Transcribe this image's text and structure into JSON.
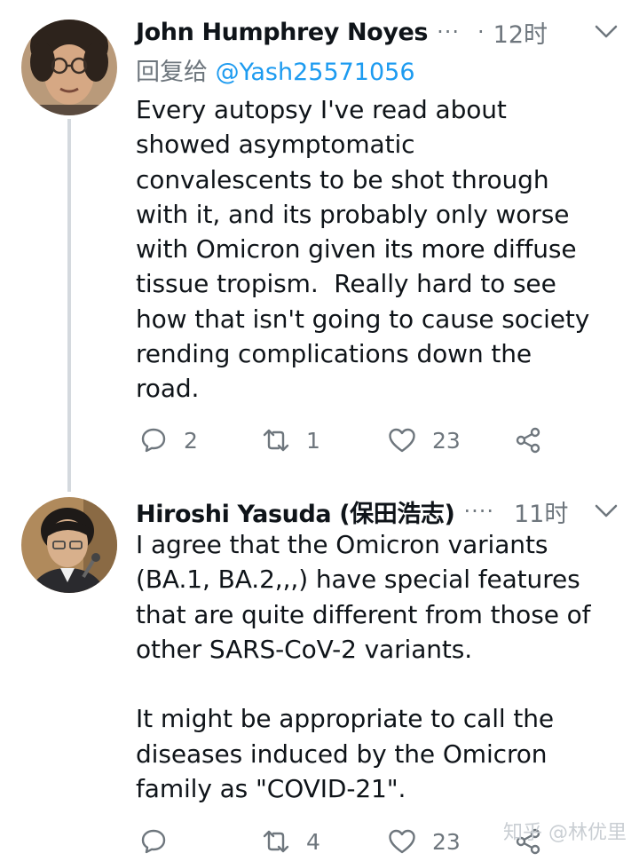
{
  "tweets": [
    {
      "author": "John Humphrey Noyes",
      "more": "···",
      "dot": "·",
      "time": "12时",
      "reply_prefix": "回复给 ",
      "reply_handle": "@Yash25571056",
      "text": "Every autopsy I've read about\nshowed asymptomatic\nconvalescents to be shot through\nwith it, and its probably only worse\nwith Omicron given its more diffuse\ntissue tropism.  Really hard to see\nhow that isn't going to cause society\nrending complications down the\nroad.",
      "replies": "2",
      "retweets": "1",
      "likes": "23",
      "avatar_icon": "profile-photo-curly-hair-glasses"
    },
    {
      "author": "Hiroshi Yasuda (保田浩志)",
      "more": "····",
      "time": "11时",
      "text": "I agree that the Omicron variants\n(BA.1, BA.2,,,) have special features\nthat are quite different from those of\nother SARS-CoV-2 variants.\n\nIt might be appropriate to call the\ndiseases induced by the Omicron\nfamily as \"COVID-21\".",
      "replies": "",
      "retweets": "4",
      "likes": "23",
      "avatar_icon": "profile-photo-speaker-microphone"
    }
  ],
  "watermark": "知乎 @林优里",
  "colors": {
    "text": "#0f1419",
    "muted": "#6e767d",
    "link": "#1d9bf0",
    "thread_line": "#d4d9de"
  }
}
